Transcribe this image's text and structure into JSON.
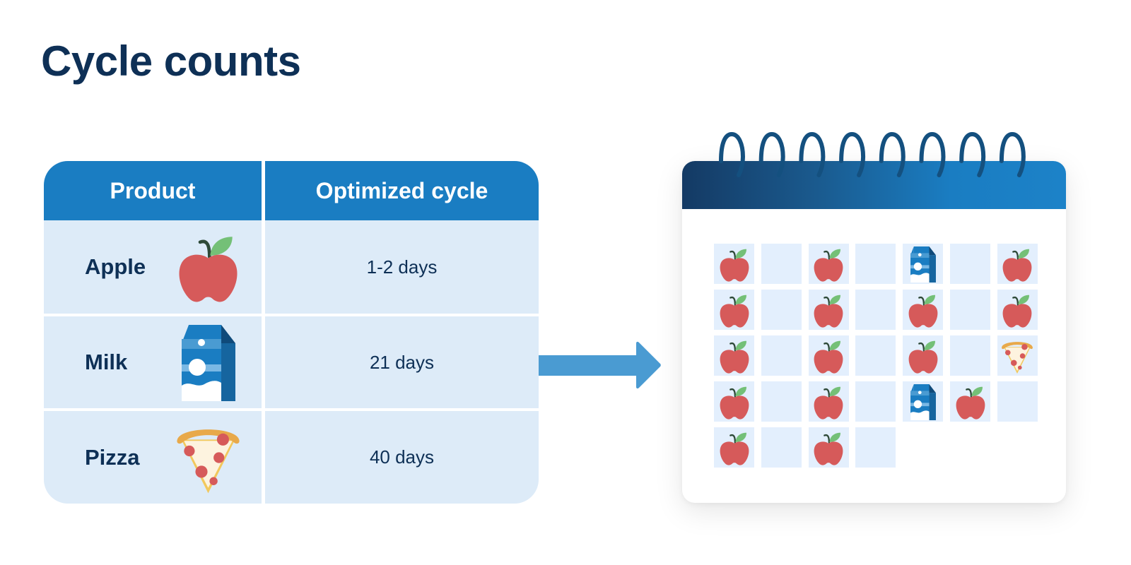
{
  "title": "Cycle counts",
  "table": {
    "headers": [
      "Product",
      "Optimized cycle"
    ],
    "rows": [
      {
        "product": "Apple",
        "icon": "apple-icon",
        "cycle": "1-2 days"
      },
      {
        "product": "Milk",
        "icon": "milk-carton-icon",
        "cycle": "21 days"
      },
      {
        "product": "Pizza",
        "icon": "pizza-slice-icon",
        "cycle": "40 days"
      }
    ]
  },
  "arrow": {
    "icon": "arrow-right-icon",
    "color": "#4a9bd2"
  },
  "calendar": {
    "ring_count": 8,
    "header_colors": [
      "#143a64",
      "#1c82c8"
    ],
    "grid": [
      [
        "apple",
        "empty",
        "apple",
        "empty",
        "milk",
        "empty",
        "apple"
      ],
      [
        "apple",
        "empty",
        "apple",
        "empty",
        "apple",
        "empty",
        "apple"
      ],
      [
        "apple",
        "empty",
        "apple",
        "empty",
        "apple",
        "empty",
        "pizza"
      ],
      [
        "apple",
        "empty",
        "apple",
        "empty",
        "milk",
        "apple",
        "empty"
      ],
      [
        "apple",
        "empty",
        "apple",
        "empty"
      ]
    ]
  },
  "colors": {
    "title": "#0e3056",
    "table_header": "#1a7dc2",
    "table_cell": "#ddebf8",
    "calendar_cell": "#e3effd",
    "apple": "#d65a5a",
    "leaf": "#74c077"
  }
}
